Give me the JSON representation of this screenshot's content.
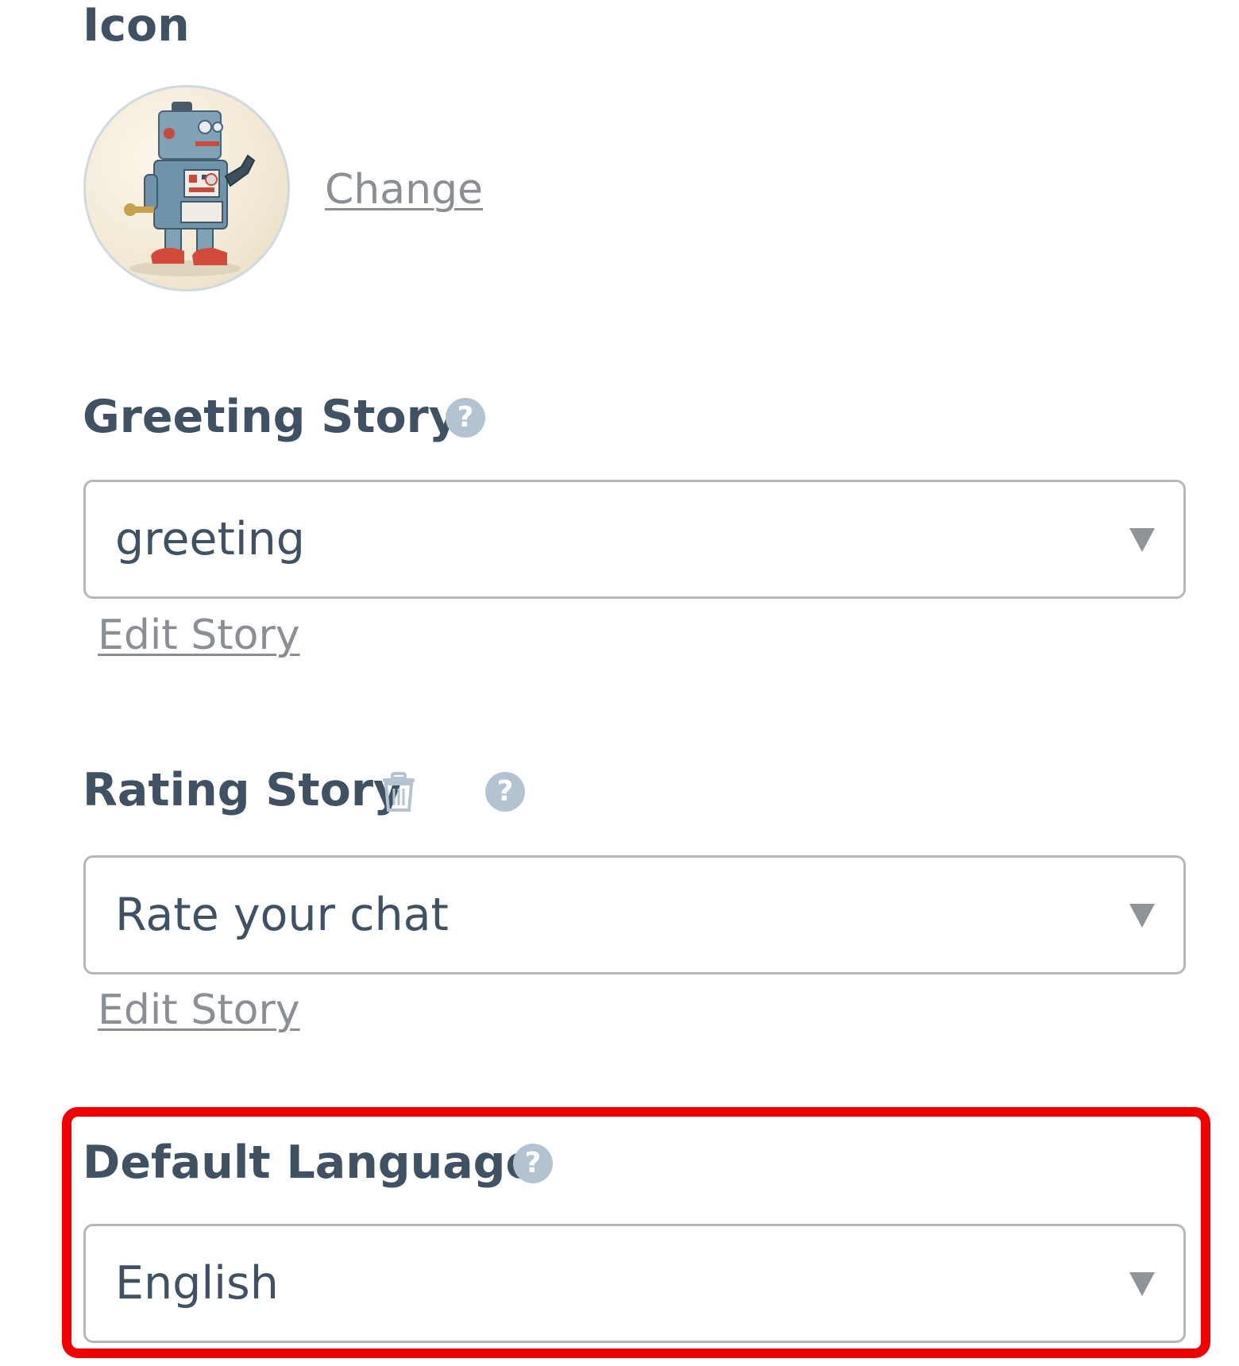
{
  "icon_section": {
    "label": "Icon",
    "change_link": "Change",
    "avatar_icon": "robot-avatar"
  },
  "greeting_story": {
    "label": "Greeting Story",
    "help_icon": "question-circle-icon",
    "help_glyph": "?",
    "selected_value": "greeting",
    "edit_link": "Edit Story"
  },
  "rating_story": {
    "label": "Rating Story",
    "delete_icon": "trash-icon",
    "help_icon": "question-circle-icon",
    "help_glyph": "?",
    "selected_value": "Rate your chat",
    "edit_link": "Edit Story"
  },
  "default_language": {
    "label": "Default Language",
    "help_icon": "question-circle-icon",
    "help_glyph": "?",
    "selected_value": "English",
    "highlighted": true,
    "highlight_color": "#f20000"
  },
  "colors": {
    "label_text": "#3f5163",
    "link_text": "#8a8f95",
    "help_icon_bg": "#b3c3d2",
    "select_border": "#b7b7b7"
  }
}
